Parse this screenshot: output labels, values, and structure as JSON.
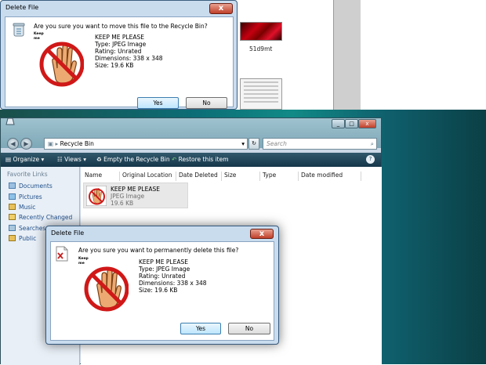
{
  "top_dialog": {
    "title": "Delete File",
    "close_glyph": "x",
    "prompt": "Are you sure you want to move this file to the Recycle Bin?",
    "file_name": "KEEP ME PLEASE",
    "type": "Type: JPEG Image",
    "rating": "Rating: Unrated",
    "dimensions": "Dimensions: 338 x 348",
    "size": "Size: 19.6 KB",
    "yes_label": "Yes",
    "no_label": "No",
    "picture_caption_line1": "Keep",
    "picture_caption_line2": "me"
  },
  "background_window": {
    "thumbnail_label": "51d9mt"
  },
  "explorer": {
    "address": "Recycle Bin",
    "search_placeholder": "Search",
    "toolbar": {
      "organize": "Organize",
      "views": "Views",
      "empty": "Empty the Recycle Bin",
      "restore": "Restore this item"
    },
    "nav_heading": "Favorite Links",
    "nav_items": [
      {
        "label": "Documents"
      },
      {
        "label": "Pictures"
      },
      {
        "label": "Music"
      },
      {
        "label": "Recently Changed"
      },
      {
        "label": "Searches"
      },
      {
        "label": "Public"
      }
    ],
    "columns": [
      "Name",
      "Original Location",
      "Date Deleted",
      "Size",
      "Type",
      "Date modified"
    ],
    "item": {
      "name": "KEEP ME PLEASE",
      "type": "JPEG Image",
      "size": "19.6 KB"
    }
  },
  "bottom_dialog": {
    "title": "Delete File",
    "close_glyph": "x",
    "prompt": "Are you sure you want to permanently delete this file?",
    "file_name": "KEEP ME PLEASE",
    "type": "Type: JPEG Image",
    "rating": "Rating: Unrated",
    "dimensions": "Dimensions: 338 x 348",
    "size": "Size: 19.6 KB",
    "yes_label": "Yes",
    "no_label": "No",
    "picture_caption_line1": "Keep",
    "picture_caption_line2": "me"
  },
  "colors": {
    "accent_blue": "#3c7fb1",
    "stop_red": "#d01818",
    "desktop_teal": "#0c6d76"
  }
}
